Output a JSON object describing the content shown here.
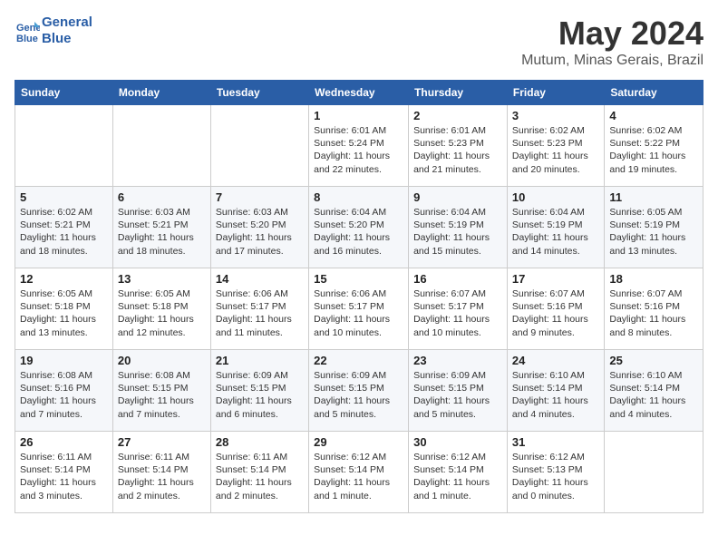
{
  "header": {
    "logo_line1": "General",
    "logo_line2": "Blue",
    "month": "May 2024",
    "location": "Mutum, Minas Gerais, Brazil"
  },
  "weekdays": [
    "Sunday",
    "Monday",
    "Tuesday",
    "Wednesday",
    "Thursday",
    "Friday",
    "Saturday"
  ],
  "weeks": [
    [
      {
        "day": "",
        "info": ""
      },
      {
        "day": "",
        "info": ""
      },
      {
        "day": "",
        "info": ""
      },
      {
        "day": "1",
        "info": "Sunrise: 6:01 AM\nSunset: 5:24 PM\nDaylight: 11 hours\nand 22 minutes."
      },
      {
        "day": "2",
        "info": "Sunrise: 6:01 AM\nSunset: 5:23 PM\nDaylight: 11 hours\nand 21 minutes."
      },
      {
        "day": "3",
        "info": "Sunrise: 6:02 AM\nSunset: 5:23 PM\nDaylight: 11 hours\nand 20 minutes."
      },
      {
        "day": "4",
        "info": "Sunrise: 6:02 AM\nSunset: 5:22 PM\nDaylight: 11 hours\nand 19 minutes."
      }
    ],
    [
      {
        "day": "5",
        "info": "Sunrise: 6:02 AM\nSunset: 5:21 PM\nDaylight: 11 hours\nand 18 minutes."
      },
      {
        "day": "6",
        "info": "Sunrise: 6:03 AM\nSunset: 5:21 PM\nDaylight: 11 hours\nand 18 minutes."
      },
      {
        "day": "7",
        "info": "Sunrise: 6:03 AM\nSunset: 5:20 PM\nDaylight: 11 hours\nand 17 minutes."
      },
      {
        "day": "8",
        "info": "Sunrise: 6:04 AM\nSunset: 5:20 PM\nDaylight: 11 hours\nand 16 minutes."
      },
      {
        "day": "9",
        "info": "Sunrise: 6:04 AM\nSunset: 5:19 PM\nDaylight: 11 hours\nand 15 minutes."
      },
      {
        "day": "10",
        "info": "Sunrise: 6:04 AM\nSunset: 5:19 PM\nDaylight: 11 hours\nand 14 minutes."
      },
      {
        "day": "11",
        "info": "Sunrise: 6:05 AM\nSunset: 5:19 PM\nDaylight: 11 hours\nand 13 minutes."
      }
    ],
    [
      {
        "day": "12",
        "info": "Sunrise: 6:05 AM\nSunset: 5:18 PM\nDaylight: 11 hours\nand 13 minutes."
      },
      {
        "day": "13",
        "info": "Sunrise: 6:05 AM\nSunset: 5:18 PM\nDaylight: 11 hours\nand 12 minutes."
      },
      {
        "day": "14",
        "info": "Sunrise: 6:06 AM\nSunset: 5:17 PM\nDaylight: 11 hours\nand 11 minutes."
      },
      {
        "day": "15",
        "info": "Sunrise: 6:06 AM\nSunset: 5:17 PM\nDaylight: 11 hours\nand 10 minutes."
      },
      {
        "day": "16",
        "info": "Sunrise: 6:07 AM\nSunset: 5:17 PM\nDaylight: 11 hours\nand 10 minutes."
      },
      {
        "day": "17",
        "info": "Sunrise: 6:07 AM\nSunset: 5:16 PM\nDaylight: 11 hours\nand 9 minutes."
      },
      {
        "day": "18",
        "info": "Sunrise: 6:07 AM\nSunset: 5:16 PM\nDaylight: 11 hours\nand 8 minutes."
      }
    ],
    [
      {
        "day": "19",
        "info": "Sunrise: 6:08 AM\nSunset: 5:16 PM\nDaylight: 11 hours\nand 7 minutes."
      },
      {
        "day": "20",
        "info": "Sunrise: 6:08 AM\nSunset: 5:15 PM\nDaylight: 11 hours\nand 7 minutes."
      },
      {
        "day": "21",
        "info": "Sunrise: 6:09 AM\nSunset: 5:15 PM\nDaylight: 11 hours\nand 6 minutes."
      },
      {
        "day": "22",
        "info": "Sunrise: 6:09 AM\nSunset: 5:15 PM\nDaylight: 11 hours\nand 5 minutes."
      },
      {
        "day": "23",
        "info": "Sunrise: 6:09 AM\nSunset: 5:15 PM\nDaylight: 11 hours\nand 5 minutes."
      },
      {
        "day": "24",
        "info": "Sunrise: 6:10 AM\nSunset: 5:14 PM\nDaylight: 11 hours\nand 4 minutes."
      },
      {
        "day": "25",
        "info": "Sunrise: 6:10 AM\nSunset: 5:14 PM\nDaylight: 11 hours\nand 4 minutes."
      }
    ],
    [
      {
        "day": "26",
        "info": "Sunrise: 6:11 AM\nSunset: 5:14 PM\nDaylight: 11 hours\nand 3 minutes."
      },
      {
        "day": "27",
        "info": "Sunrise: 6:11 AM\nSunset: 5:14 PM\nDaylight: 11 hours\nand 2 minutes."
      },
      {
        "day": "28",
        "info": "Sunrise: 6:11 AM\nSunset: 5:14 PM\nDaylight: 11 hours\nand 2 minutes."
      },
      {
        "day": "29",
        "info": "Sunrise: 6:12 AM\nSunset: 5:14 PM\nDaylight: 11 hours\nand 1 minute."
      },
      {
        "day": "30",
        "info": "Sunrise: 6:12 AM\nSunset: 5:14 PM\nDaylight: 11 hours\nand 1 minute."
      },
      {
        "day": "31",
        "info": "Sunrise: 6:12 AM\nSunset: 5:13 PM\nDaylight: 11 hours\nand 0 minutes."
      },
      {
        "day": "",
        "info": ""
      }
    ]
  ]
}
